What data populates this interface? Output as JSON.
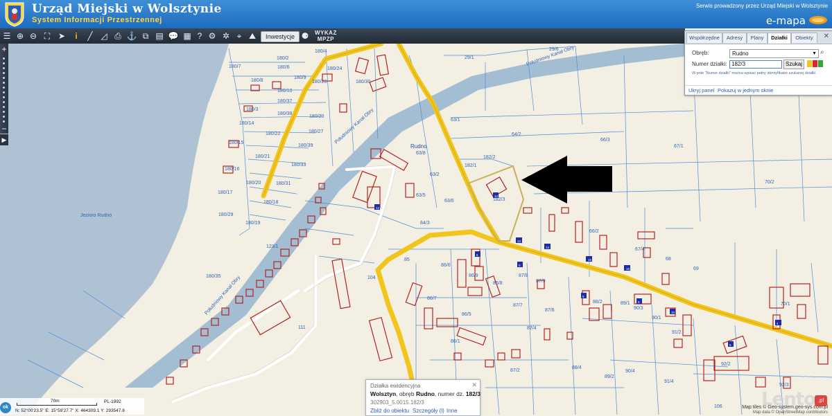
{
  "header": {
    "title": "Urząd Miejski w Wolsztynie",
    "subtitle": "System Informacji Przestrzennej",
    "service_note": "Serwis prowadzony przez Urząd Miejski w Wolsztynie",
    "brand": "e-mapa"
  },
  "toolbar": {
    "icons": [
      "layers-icon",
      "zoom-in-icon",
      "zoom-out-icon",
      "zoom-extent-icon",
      "select-arrow-icon",
      "info-icon",
      "measure-line-icon",
      "measure-area-icon",
      "print-icon",
      "anchor-icon",
      "export-icon",
      "layout-icon",
      "comment-icon",
      "parcel-icon",
      "help-icon",
      "settings-icon",
      "map-pin-icon",
      "terrain-icon"
    ],
    "investments_label": "Inwestycje",
    "wykaz_label_1": "WYKAZ",
    "wykaz_label_2": "MPZP"
  },
  "search_panel": {
    "tabs": [
      "Współrzędne",
      "Adresy",
      "Plany",
      "Działki",
      "Obiekty"
    ],
    "active_tab": "Działki",
    "obreb_label": "Obręb:",
    "obreb_value": "Rudno",
    "parcel_label": "Numer działki:",
    "parcel_value": "182/3",
    "search_button": "Szukaj",
    "hint": "W pole \"Numer działki\" można wpisać pełny identyfikator szukanej działki.",
    "hide_link": "Ukryj panel",
    "one_window_link": "Pokazuj w jednym oknie"
  },
  "map": {
    "place_labels": {
      "village": "Rudno",
      "lake": "Jezioro Rudno",
      "canal_1": "Południowy Kanał Obry",
      "canal_2": "Południowy Kanał Obry",
      "canal_3": "Południowy Kanał Obry"
    },
    "parcel_labels": [
      "180/4",
      "180/2",
      "180/7",
      "180/6",
      "180/24",
      "180/8",
      "180/9",
      "180/10",
      "180/26",
      "180/30",
      "180/3",
      "180/37",
      "180/38",
      "180/14",
      "180/22",
      "180/27",
      "180/20",
      "180/39",
      "180/15",
      "180/21",
      "180/33",
      "180/16",
      "180/20",
      "180/31",
      "180/17",
      "180/18",
      "180/29",
      "180/19",
      "180/35",
      "29/1",
      "29/6",
      "63/1",
      "64/2",
      "66/3",
      "67/1",
      "182/2",
      "182/1",
      "182/3",
      "63/8",
      "63/2",
      "63/5",
      "63/6",
      "70/2",
      "84/3",
      "66/2",
      "67/4",
      "68",
      "69",
      "85",
      "86/6",
      "86/9",
      "86/8",
      "87/9",
      "87/8",
      "87/7",
      "87/6",
      "87/4",
      "86/7",
      "86/5",
      "86/1",
      "88/2",
      "89/1",
      "90/3",
      "90/1",
      "91/2",
      "70/1",
      "104",
      "111",
      "88/4",
      "87/2",
      "89/2",
      "90/4",
      "91/4",
      "92/2",
      "92/3",
      "106",
      "123/1"
    ],
    "building_numbers": [
      "14",
      "12",
      "13",
      "14",
      "15",
      "16",
      "6",
      "9",
      "6",
      "8",
      "10",
      "4",
      "6",
      "18",
      "8"
    ]
  },
  "popup": {
    "title": "Działka ewidencyjna",
    "line_city": "Wolsztyn",
    "line_mid1": ", obręb ",
    "line_obreb": "Rudno",
    "line_mid2": ", numer dz. ",
    "line_number": "182/3",
    "identifier": "302903_5.0015.182/3",
    "link_zoom": "Zbliż do obiektu",
    "link_details": "Szczegóły (l)",
    "link_other": "Inne"
  },
  "status": {
    "ok_label": "ok",
    "scale_label": "70m",
    "crs": "PL-1992",
    "coords": "N: 52°00'23.5\"   E: 15°59'27.7\"   X: 464309.1   Y: 293547.8"
  },
  "attribution": {
    "tiles": "Map tiles © Geo-system.geo-sys.com.pl",
    "data": "Map data © OpenStreetMap contributors"
  },
  "watermark": {
    "text": "Lento",
    "suffix": ".pl"
  },
  "colors": {
    "road": "#f2c51d",
    "lake": "#afc2d4",
    "canal": "#a3bdd2",
    "parcel_line": "#4a8fd8",
    "building": "#b22222",
    "selected_parcel": "#c9b15a",
    "header": "#2a79c9"
  }
}
